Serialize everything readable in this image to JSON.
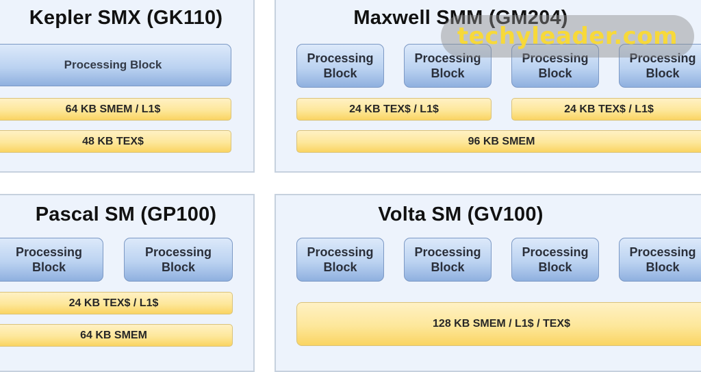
{
  "panels": {
    "kepler": {
      "title": "Kepler SMX (GK110)",
      "processing_blocks": [
        "Processing Block"
      ],
      "memory": [
        "64 KB SMEM / L1$",
        "48 KB TEX$"
      ]
    },
    "maxwell": {
      "title": "Maxwell SMM (GM204)",
      "processing_blocks": [
        "Processing\nBlock",
        "Processing\nBlock",
        "Processing\nBlock",
        "Processing\nBlock"
      ],
      "memory": [
        "24 KB TEX$ / L1$",
        "24 KB TEX$ / L1$",
        "96 KB SMEM"
      ]
    },
    "pascal": {
      "title": "Pascal SM (GP100)",
      "processing_blocks": [
        "Processing\nBlock",
        "Processing\nBlock"
      ],
      "memory": [
        "24 KB TEX$ / L1$",
        "64 KB SMEM"
      ]
    },
    "volta": {
      "title": "Volta SM (GV100)",
      "processing_blocks": [
        "Processing\nBlock",
        "Processing\nBlock",
        "Processing\nBlock",
        "Processing\nBlock"
      ],
      "memory": [
        "128 KB SMEM / L1$ / TEX$"
      ]
    }
  },
  "watermark": "techyleader.com",
  "colors": {
    "panel_bg": "#edf3fc",
    "processing_block": "#bcd3f1",
    "memory": "#fde79a",
    "watermark_text": "#f7d93a"
  }
}
